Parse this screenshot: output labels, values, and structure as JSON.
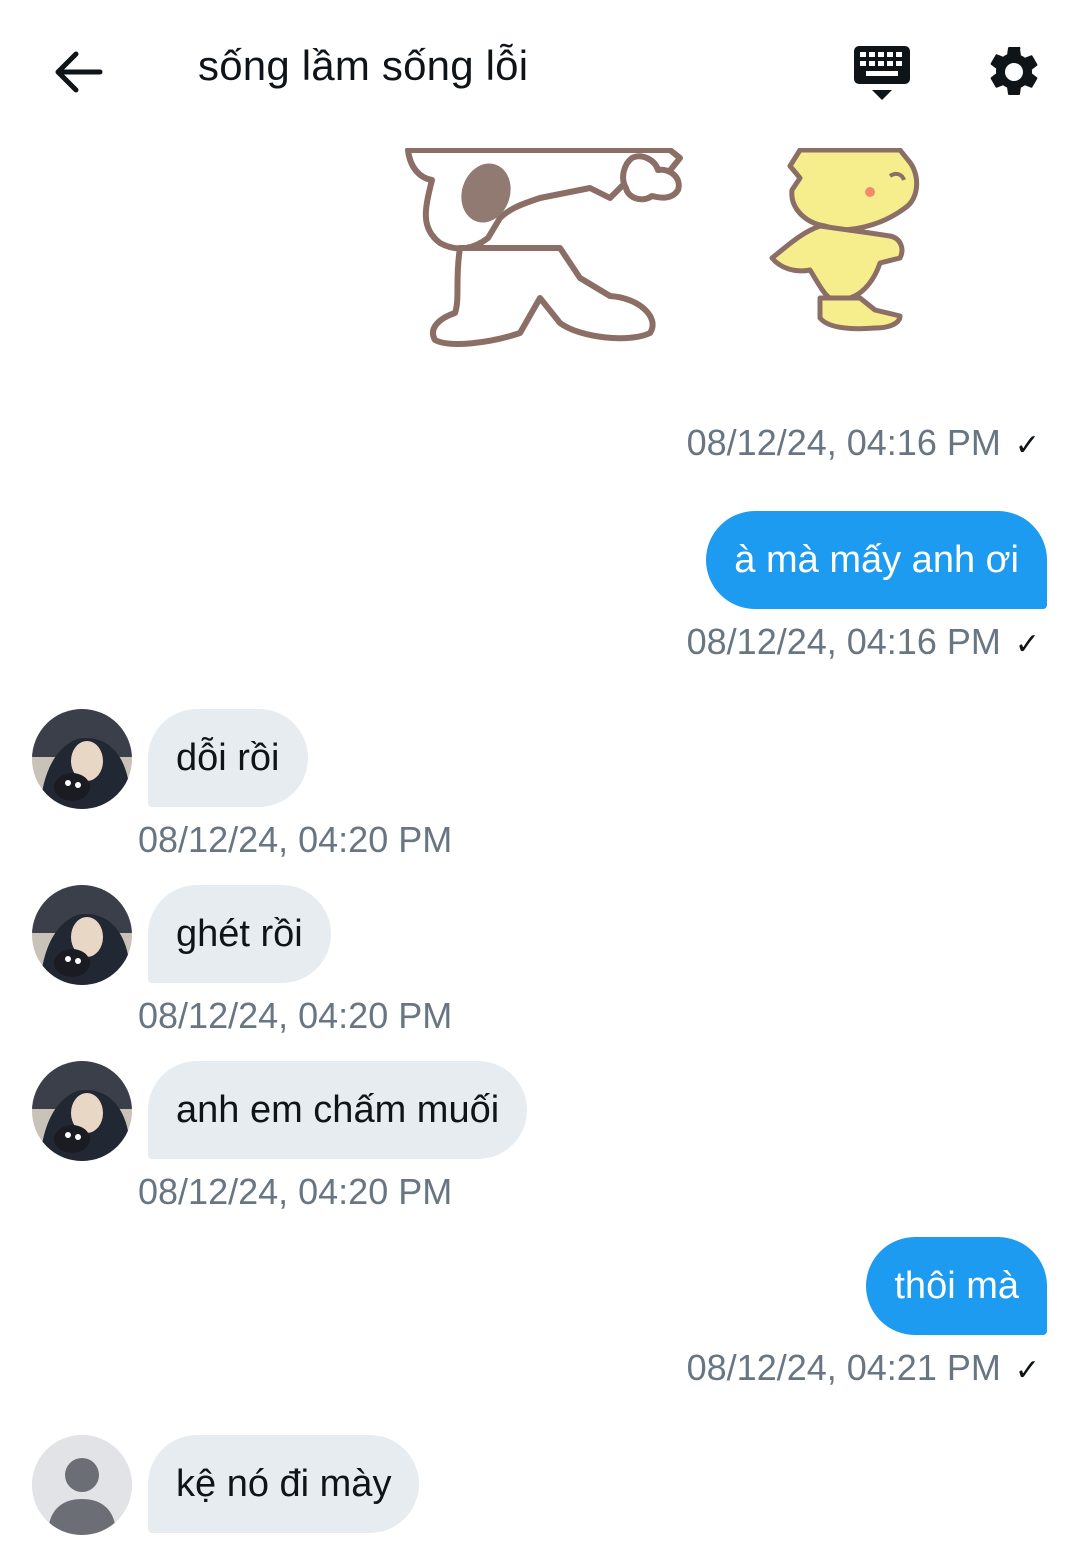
{
  "header": {
    "title": "sống lầm sống lỗi"
  },
  "icons": {
    "back": "arrow-left-icon",
    "keyboard": "keyboard-icon",
    "settings": "gear-icon"
  },
  "colors": {
    "outgoing_bubble": "#1d9bf0",
    "incoming_bubble": "#e7ecf0",
    "timestamp": "#687684"
  },
  "sticker": {
    "description_icon": "snoopy-woodstock-sticker"
  },
  "messages": [
    {
      "type": "sticker",
      "direction": "out",
      "time": "08/12/24, 04:16 PM",
      "read": "✓"
    },
    {
      "type": "text",
      "direction": "out",
      "text": "à mà mấy anh ơi",
      "time": "08/12/24, 04:16 PM",
      "read": "✓"
    },
    {
      "type": "text",
      "direction": "in",
      "text": "dỗi rồi",
      "time": "08/12/24, 04:20 PM"
    },
    {
      "type": "text",
      "direction": "in",
      "text": "ghét rồi",
      "time": "08/12/24, 04:20 PM"
    },
    {
      "type": "text",
      "direction": "in",
      "text": "anh em chấm muối",
      "time": "08/12/24, 04:20 PM"
    },
    {
      "type": "text",
      "direction": "out",
      "text": "thôi mà",
      "time": "08/12/24, 04:21 PM",
      "read": "✓"
    },
    {
      "type": "text",
      "direction": "in",
      "text": "kệ nó đi mày"
    }
  ]
}
